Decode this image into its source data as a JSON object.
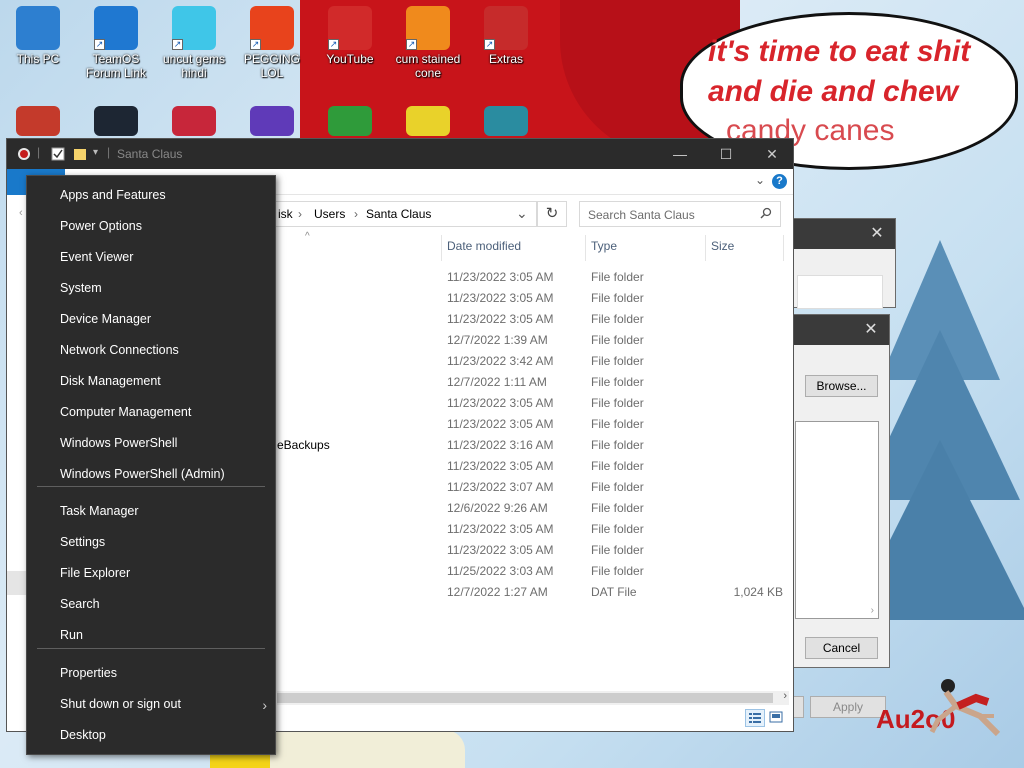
{
  "desktop": {
    "icons_row1": [
      {
        "label": "This PC",
        "icon": "this-pc-icon",
        "color": "#2d7fd0"
      },
      {
        "label": "TeamOS Forum Link",
        "icon": "gear-icon",
        "color": "#1f78d1"
      },
      {
        "label": "uncut gems hindi",
        "icon": "diamond-icon",
        "color": "#3fc6e8"
      },
      {
        "label": "PEGGING LOL",
        "icon": "p-logo-icon",
        "color": "#e8431c"
      },
      {
        "label": "YouTube",
        "icon": "angry-bird-icon",
        "color": "#d12a2a"
      },
      {
        "label": "cum stained cone",
        "icon": "traffic-cone-icon",
        "color": "#f08a1c"
      },
      {
        "label": "Extras",
        "icon": "gift-icon",
        "color": "#c62b2b"
      }
    ],
    "icons_row2": [
      {
        "icon": "ornament-icon",
        "color": "#c43a2b"
      },
      {
        "icon": "book-icon",
        "color": "#1d2633"
      },
      {
        "icon": "balloon-icon",
        "color": "#c7263a"
      },
      {
        "icon": "orb-icon",
        "color": "#5f3ab8"
      },
      {
        "icon": "csharp-icon",
        "color": "#2f9b3a"
      },
      {
        "icon": "hxd-icon",
        "color": "#e9d22a"
      },
      {
        "icon": "snake-icon",
        "color": "#2a8ca0"
      }
    ],
    "speech_bubble": {
      "line1": "it's time to eat shit",
      "line2": "and die and chew",
      "line3": "candy canes"
    },
    "corner_text": "Au2o0"
  },
  "explorer": {
    "title": "Santa Claus",
    "breadcrumb": [
      "isk",
      "Users",
      "Santa Claus"
    ],
    "search_placeholder": "Search Santa Claus",
    "columns": {
      "date": "Date modified",
      "type": "Type",
      "size": "Size"
    },
    "rows": [
      {
        "name": "",
        "date": "11/23/2022 3:05 AM",
        "type": "File folder",
        "size": ""
      },
      {
        "name": "",
        "date": "11/23/2022 3:05 AM",
        "type": "File folder",
        "size": ""
      },
      {
        "name": "",
        "date": "11/23/2022 3:05 AM",
        "type": "File folder",
        "size": ""
      },
      {
        "name": "",
        "date": "12/7/2022 1:39 AM",
        "type": "File folder",
        "size": ""
      },
      {
        "name": "",
        "date": "11/23/2022 3:42 AM",
        "type": "File folder",
        "size": ""
      },
      {
        "name": "",
        "date": "12/7/2022 1:11 AM",
        "type": "File folder",
        "size": ""
      },
      {
        "name": "",
        "date": "11/23/2022 3:05 AM",
        "type": "File folder",
        "size": ""
      },
      {
        "name": "",
        "date": "11/23/2022 3:05 AM",
        "type": "File folder",
        "size": ""
      },
      {
        "name": "eBackups",
        "date": "11/23/2022 3:16 AM",
        "type": "File folder",
        "size": ""
      },
      {
        "name": "",
        "date": "11/23/2022 3:05 AM",
        "type": "File folder",
        "size": ""
      },
      {
        "name": "",
        "date": "11/23/2022 3:07 AM",
        "type": "File folder",
        "size": ""
      },
      {
        "name": "",
        "date": "12/6/2022 9:26 AM",
        "type": "File folder",
        "size": ""
      },
      {
        "name": "",
        "date": "11/23/2022 3:05 AM",
        "type": "File folder",
        "size": ""
      },
      {
        "name": "",
        "date": "11/23/2022 3:05 AM",
        "type": "File folder",
        "size": ""
      },
      {
        "name": "",
        "date": "11/25/2022 3:03 AM",
        "type": "File folder",
        "size": ""
      },
      {
        "name": "",
        "date": "12/7/2022 1:27 AM",
        "type": "DAT File",
        "size": "1,024 KB"
      }
    ]
  },
  "dialog": {
    "browse_label": "Browse...",
    "cancel_label": "Cancel",
    "apply_label": "Apply"
  },
  "winx_menu": {
    "group1": [
      "Apps and Features",
      "Power Options",
      "Event Viewer",
      "System",
      "Device Manager",
      "Network Connections",
      "Disk Management",
      "Computer Management",
      "Windows PowerShell",
      "Windows PowerShell (Admin)"
    ],
    "group2": [
      "Task Manager",
      "Settings",
      "File Explorer",
      "Search",
      "Run"
    ],
    "group3": [
      "Properties",
      "Shut down or sign out",
      "Desktop"
    ]
  },
  "colors": {
    "menu_bg": "#2b2b2b",
    "accent": "#1979ca",
    "hat_red": "#c8141a"
  }
}
